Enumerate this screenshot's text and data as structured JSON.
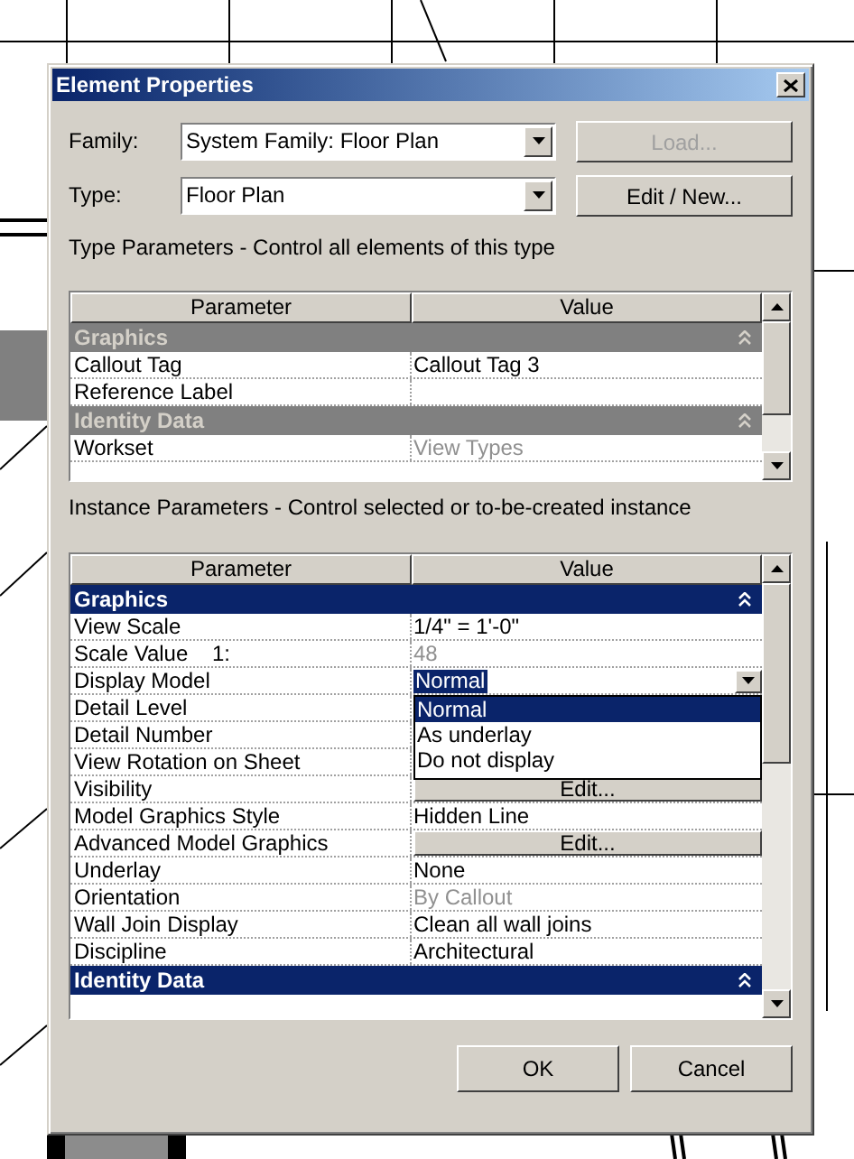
{
  "window": {
    "title": "Element Properties"
  },
  "family": {
    "label": "Family:",
    "value": "System Family: Floor Plan"
  },
  "type": {
    "label": "Type:",
    "value": "Floor Plan"
  },
  "buttons_side": [
    {
      "label": "Load...",
      "disabled": true
    },
    {
      "label": "Edit / New...",
      "disabled": false
    }
  ],
  "type_parameters": {
    "caption": "Type Parameters - Control all elements of this type",
    "active": false,
    "columns": [
      "Parameter",
      "Value"
    ],
    "sections": [
      {
        "title": "Graphics",
        "rows": [
          {
            "name": "Callout Tag",
            "value": "Callout Tag 3",
            "kind": "text"
          },
          {
            "name": "Reference Label",
            "kind": "text"
          }
        ]
      },
      {
        "title": "Identity Data",
        "rows": [
          {
            "name": "Workset",
            "value": "View Types",
            "kind": "readonly"
          }
        ]
      }
    ]
  },
  "instance_parameters": {
    "caption": "Instance Parameters - Control selected or to-be-created instance",
    "active": true,
    "columns": [
      "Parameter",
      "Value"
    ],
    "sections": [
      {
        "title": "Graphics",
        "rows": [
          {
            "name": "View Scale",
            "value": "1/4\" = 1'-0\"",
            "kind": "text"
          },
          {
            "name": "Scale Value    1:",
            "value": "48",
            "kind": "readonly"
          },
          {
            "name": "Display Model",
            "value": "Normal",
            "kind": "combo",
            "options": [
              {
                "label": "Normal",
                "selected": true
              },
              {
                "label": "As underlay",
                "selected": false
              },
              {
                "label": "Do not display",
                "selected": false
              }
            ]
          },
          {
            "name": "Detail Level",
            "kind": "text"
          },
          {
            "name": "Detail Number",
            "kind": "text"
          },
          {
            "name": "View Rotation on Sheet",
            "kind": "text"
          },
          {
            "name": "Visibility",
            "value": "Edit...",
            "kind": "button"
          },
          {
            "name": "Model Graphics Style",
            "value": "Hidden Line",
            "kind": "text"
          },
          {
            "name": "Advanced Model Graphics",
            "value": "Edit...",
            "kind": "button"
          },
          {
            "name": "Underlay",
            "value": "None",
            "kind": "text"
          },
          {
            "name": "Orientation",
            "value": "By Callout",
            "kind": "readonly"
          },
          {
            "name": "Wall Join Display",
            "value": "Clean all wall joins",
            "kind": "text"
          },
          {
            "name": "Discipline",
            "value": "Architectural",
            "kind": "text"
          }
        ]
      },
      {
        "title": "Identity Data"
      }
    ]
  },
  "buttons": [
    "OK",
    "Cancel"
  ]
}
